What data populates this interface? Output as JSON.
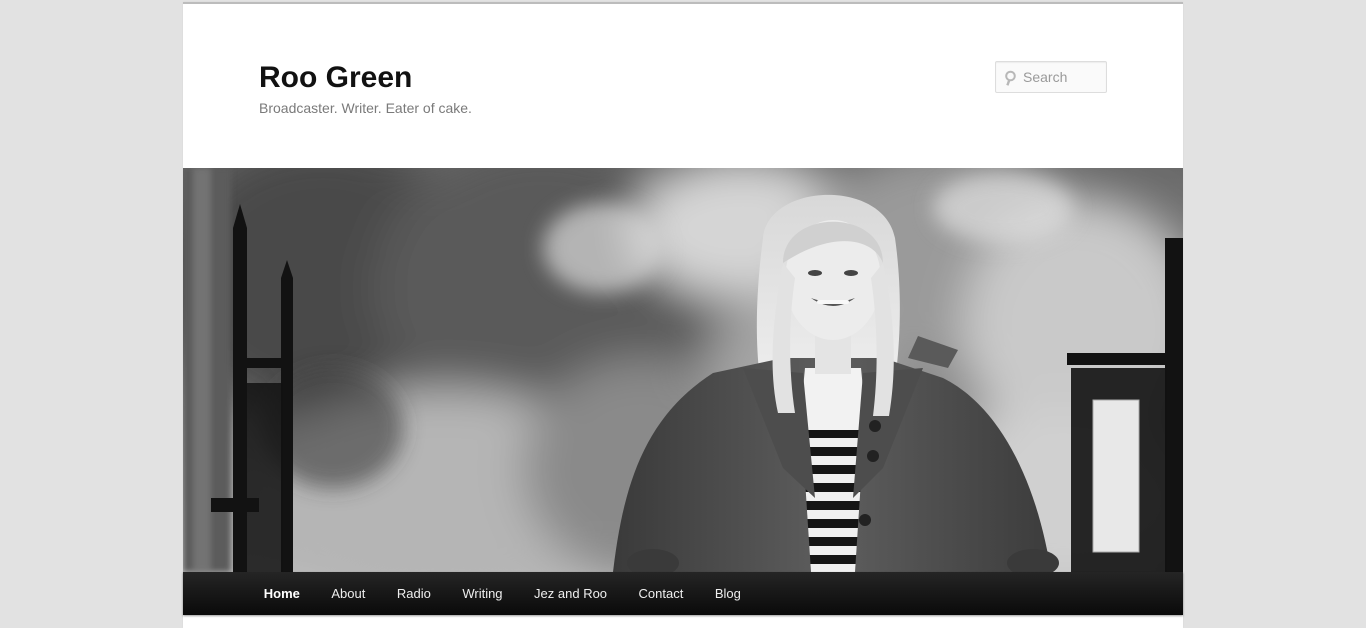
{
  "site": {
    "title": "Roo Green",
    "description": "Broadcaster. Writer. Eater of cake."
  },
  "search": {
    "placeholder": "Search",
    "icon": "search-icon"
  },
  "header_image": {
    "alt": "Roo Green",
    "style": "black-and-white photograph"
  },
  "nav": {
    "items": [
      {
        "label": "Home",
        "current": true
      },
      {
        "label": "About"
      },
      {
        "label": "Radio"
      },
      {
        "label": "Writing"
      },
      {
        "label": "Jez and Roo"
      },
      {
        "label": "Contact"
      },
      {
        "label": "Blog"
      }
    ]
  },
  "colors": {
    "background": "#e2e2e2",
    "page": "#ffffff",
    "title": "#111111",
    "description": "#7a7a7a",
    "nav_bar": "#0a0a0a",
    "nav_text": "#eeeeee"
  }
}
